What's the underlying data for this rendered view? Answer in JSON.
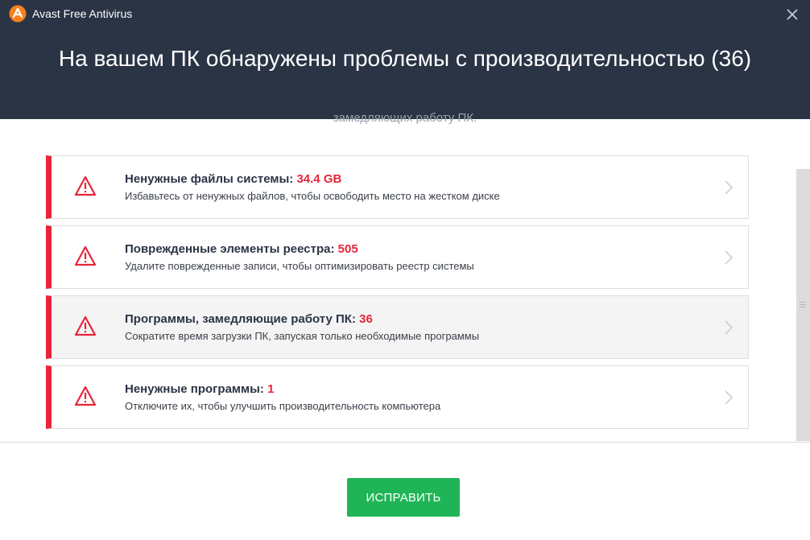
{
  "window": {
    "title": "Avast Free Antivirus",
    "logo_icon": "avast-logo-icon",
    "close_icon": "close-icon"
  },
  "header": {
    "heading": "На вашем ПК обнаружены проблемы с производительностью (36)"
  },
  "partial_subtitle": "замедляющих работу ПК.",
  "issues": [
    {
      "title": "Ненужные файлы системы:",
      "count": "34.4 GB",
      "description": "Избавьтесь от ненужных файлов, чтобы освободить место на жестком диске"
    },
    {
      "title": "Поврежденные элементы реестра:",
      "count": "505",
      "description": "Удалите поврежденные записи, чтобы оптимизировать реестр системы"
    },
    {
      "title": "Программы, замедляющие работу ПК:",
      "count": "36",
      "description": "Сократите время загрузки ПК, запуская только необходимые программы"
    },
    {
      "title": "Ненужные программы:",
      "count": "1",
      "description": "Отключите их, чтобы улучшить производительность компьютера"
    }
  ],
  "fix_button": {
    "label": "ИСПРАВИТЬ"
  },
  "colors": {
    "header_bg": "#2b3445",
    "alert_red": "#e8253a",
    "fix_green": "#1fb556",
    "logo_orange": "#f58220"
  }
}
